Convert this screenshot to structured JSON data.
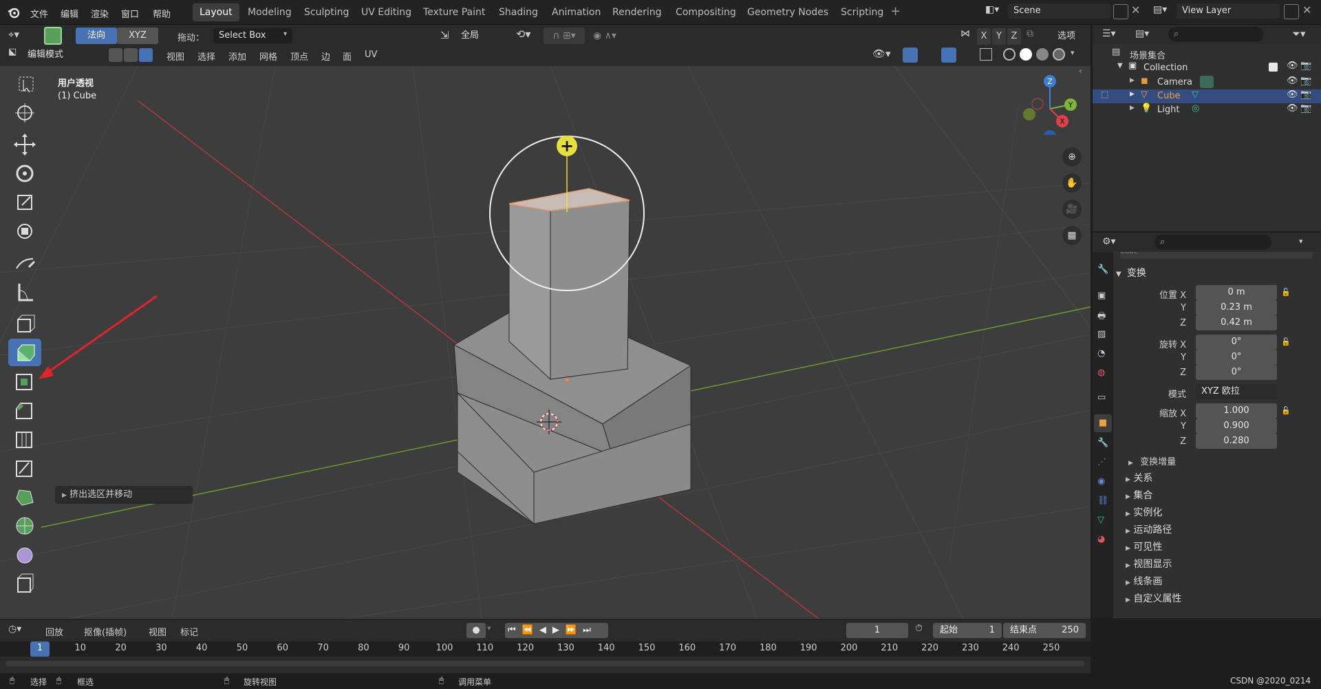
{
  "menus": [
    "文件",
    "编辑",
    "渲染",
    "窗口",
    "帮助"
  ],
  "workspace_tabs": [
    "Layout",
    "Modeling",
    "Sculpting",
    "UV Editing",
    "Texture Paint",
    "Shading",
    "Animation",
    "Rendering",
    "Compositing",
    "Geometry Nodes",
    "Scripting"
  ],
  "scene": "Scene",
  "view_layer": "View Layer",
  "toolbar": {
    "orientation_a": "法向",
    "orientation_b": "XYZ",
    "drag_label": "拖动：",
    "drag_value": "Select Box",
    "global": "全局",
    "options": "选项",
    "axis_x": "X",
    "axis_y": "Y",
    "axis_z": "Z"
  },
  "mode": "编辑模式",
  "edit_menus": [
    "视图",
    "选择",
    "添加",
    "网格",
    "顶点",
    "边",
    "面",
    "UV"
  ],
  "viewport": {
    "view_name": "用户透视",
    "object_name": "(1) Cube",
    "operator_panel": "挤出选区并移动",
    "gizmo_x": "X",
    "gizmo_y": "Y",
    "gizmo_z": "Z"
  },
  "outliner": {
    "root": "场景集合",
    "collection": "Collection",
    "items": [
      "Camera",
      "Cube",
      "Light"
    ],
    "selected": "Cube"
  },
  "properties": {
    "object_name": "Cube",
    "section": "变换",
    "location_label": "位置 X",
    "location": [
      "0 m",
      "0.23 m",
      "0.42 m"
    ],
    "rotation_label": "旋转 X",
    "rotation": [
      "0°",
      "0°",
      "0°"
    ],
    "mode_label": "模式",
    "mode_value": "XYZ 欧拉",
    "scale_label": "缩放 X",
    "scale": [
      "1.000",
      "0.900",
      "0.280"
    ],
    "axis_y": "Y",
    "axis_z": "Z",
    "delta": "变换增量",
    "panels": [
      "关系",
      "集合",
      "实例化",
      "运动路径",
      "可见性",
      "视图显示",
      "线条画",
      "自定义属性"
    ]
  },
  "timeline": {
    "playback": "回放",
    "keying": "抠像(插帧)",
    "view": "视图",
    "marker": "标记",
    "current_frame": "1",
    "start_label": "起始",
    "start": "1",
    "end_label": "结束点",
    "end": "250",
    "ruler": [
      "1",
      "10",
      "20",
      "30",
      "40",
      "50",
      "60",
      "70",
      "80",
      "90",
      "100",
      "110",
      "120",
      "130",
      "140",
      "150",
      "160",
      "170",
      "180",
      "190",
      "200",
      "210",
      "220",
      "230",
      "240",
      "250"
    ]
  },
  "status": {
    "select": "选择",
    "box_select": "框选",
    "rotate_view": "旋转视图",
    "call_menu": "调用菜单",
    "watermark": "CSDN @2020_0214"
  },
  "colors": {
    "accent": "#4772b3",
    "selected_row": "#334d80",
    "x_axis": "#c0393b",
    "y_axis": "#6f9a2b"
  }
}
